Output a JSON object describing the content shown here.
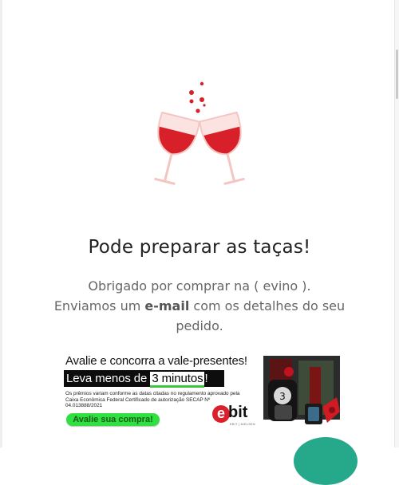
{
  "confirmation": {
    "title": "Pode preparar as taças!",
    "message_line1": "Obrigado por comprar na ( evino ).",
    "message_line2_before": "Enviamos um ",
    "message_line2_bold": "e-mail",
    "message_line2_after": " com os detalhes do seu",
    "message_line3": "pedido."
  },
  "banner": {
    "heading": "Avalie e concorra a vale-presentes!",
    "pill_before": "Leva menos de ",
    "pill_highlight": "3 minutos",
    "pill_after": "!",
    "fine_print": "Os prêmios variam conforme as datas citadas no regulamento aprovado pela Caixa Econômica Federal Certificado de autorização SECAP Nº 04.013888/2021",
    "cta_label": "Avalie sua compra!",
    "brand_letter": "e",
    "brand_rest": "bit",
    "brand_sub": "EBIT | NIELSEN"
  },
  "icons": {
    "illustration": "wine-toast-icon",
    "products": "products-image",
    "floating_button": "chat-fab"
  },
  "colors": {
    "wine": "#d8202a",
    "glass_outline": "#f3c6c2",
    "cta_green": "#2ee040",
    "ebit_red": "#d9202b",
    "fab_teal": "#26a88a"
  }
}
